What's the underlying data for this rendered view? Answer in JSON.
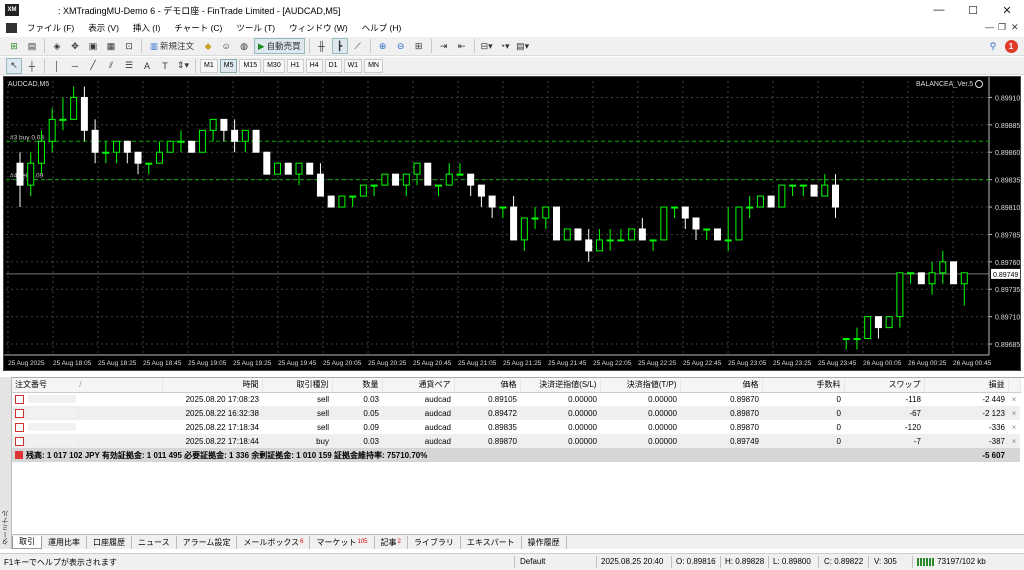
{
  "window": {
    "app_icon_text": "XM",
    "title": ": XMTradingMU-Demo 6 - デモロ座 - FinTrade Limited - [AUDCAD,M5]",
    "minimize": "—",
    "maximize": "☐",
    "close": "✕"
  },
  "menu": {
    "items": [
      "ファイル (F)",
      "表示 (V)",
      "挿入 (I)",
      "チャート (C)",
      "ツール (T)",
      "ウィンドウ (W)",
      "ヘルプ (H)"
    ],
    "mdi_min": "—",
    "mdi_restore": "❐",
    "mdi_close": "✕"
  },
  "toolbar": {
    "new_order": "新規注文",
    "auto_trading": "自動売買",
    "notification_count": "1",
    "timeframes": [
      "M1",
      "M5",
      "M15",
      "M30",
      "H1",
      "H4",
      "D1",
      "W1",
      "MN"
    ],
    "active_timeframe": "M5"
  },
  "chart": {
    "symbol_label": "AUDCAD,M5",
    "indicator_label": "BALANCEA_Ver.5",
    "current_price": "0.89749",
    "order_labels": [
      "#3 buy 0.03",
      "#4 sell 0.09"
    ],
    "colors": {
      "background": "#000000",
      "bull": "#00ff00",
      "bear": "#ffffff",
      "grid": "#404040",
      "order_line": "#00b000"
    }
  },
  "chart_data": {
    "type": "candlestick",
    "price_ticks": [
      "0.89910",
      "0.89885",
      "0.89860",
      "0.89835",
      "0.89810",
      "0.89785",
      "0.89760",
      "0.89735",
      "0.89710",
      "0.89685"
    ],
    "time_ticks": [
      "25 Aug 2025",
      "25 Aug 18:05",
      "25 Aug 18:25",
      "25 Aug 18:45",
      "25 Aug 19:05",
      "25 Aug 19:25",
      "25 Aug 19:45",
      "25 Aug 20:05",
      "25 Aug 20:25",
      "25 Aug 20:45",
      "25 Aug 21:05",
      "25 Aug 21:25",
      "25 Aug 21:45",
      "25 Aug 22:05",
      "25 Aug 22:25",
      "25 Aug 22:45",
      "25 Aug 23:05",
      "25 Aug 23:25",
      "25 Aug 23:45",
      "26 Aug 00:05",
      "26 Aug 00:25",
      "26 Aug 00:45"
    ],
    "ylim": [
      0.89675,
      0.89925
    ],
    "order_levels": [
      0.8987,
      0.89835
    ],
    "current_level": 0.89749,
    "candles": [
      [
        0.8985,
        0.8986,
        0.8981,
        0.8983
      ],
      [
        0.8983,
        0.8986,
        0.8982,
        0.8985
      ],
      [
        0.8985,
        0.8988,
        0.8984,
        0.8987
      ],
      [
        0.8987,
        0.899,
        0.8986,
        0.8989
      ],
      [
        0.8989,
        0.8991,
        0.8988,
        0.8989
      ],
      [
        0.8989,
        0.8992,
        0.8989,
        0.8991
      ],
      [
        0.8991,
        0.8992,
        0.8987,
        0.8988
      ],
      [
        0.8988,
        0.8989,
        0.8985,
        0.8986
      ],
      [
        0.8986,
        0.8987,
        0.8985,
        0.8986
      ],
      [
        0.8986,
        0.8987,
        0.8985,
        0.8987
      ],
      [
        0.8987,
        0.8987,
        0.8985,
        0.8986
      ],
      [
        0.8986,
        0.8986,
        0.8984,
        0.8985
      ],
      [
        0.8985,
        0.8985,
        0.8984,
        0.8985
      ],
      [
        0.8985,
        0.8987,
        0.8985,
        0.8986
      ],
      [
        0.8986,
        0.8987,
        0.8986,
        0.8987
      ],
      [
        0.8987,
        0.8988,
        0.8986,
        0.8987
      ],
      [
        0.8987,
        0.8987,
        0.8986,
        0.8986
      ],
      [
        0.8986,
        0.8988,
        0.8986,
        0.8988
      ],
      [
        0.8988,
        0.8989,
        0.8987,
        0.8989
      ],
      [
        0.8989,
        0.8989,
        0.8987,
        0.8988
      ],
      [
        0.8988,
        0.8989,
        0.8986,
        0.8987
      ],
      [
        0.8987,
        0.8988,
        0.8986,
        0.8988
      ],
      [
        0.8988,
        0.8988,
        0.8986,
        0.8986
      ],
      [
        0.8986,
        0.8986,
        0.8984,
        0.8984
      ],
      [
        0.8984,
        0.8985,
        0.8984,
        0.8985
      ],
      [
        0.8985,
        0.8985,
        0.8984,
        0.8984
      ],
      [
        0.8984,
        0.8985,
        0.8983,
        0.8985
      ],
      [
        0.8985,
        0.8985,
        0.8984,
        0.8984
      ],
      [
        0.8984,
        0.8985,
        0.8982,
        0.8982
      ],
      [
        0.8982,
        0.8982,
        0.8981,
        0.8981
      ],
      [
        0.8981,
        0.8982,
        0.8981,
        0.8982
      ],
      [
        0.8982,
        0.8982,
        0.8981,
        0.8982
      ],
      [
        0.8982,
        0.8983,
        0.8982,
        0.8983
      ],
      [
        0.8983,
        0.8983,
        0.8982,
        0.8983
      ],
      [
        0.8983,
        0.8984,
        0.8983,
        0.8984
      ],
      [
        0.8984,
        0.8984,
        0.8983,
        0.8983
      ],
      [
        0.8983,
        0.8984,
        0.8982,
        0.8984
      ],
      [
        0.8984,
        0.8985,
        0.8983,
        0.8985
      ],
      [
        0.8985,
        0.8985,
        0.8983,
        0.8983
      ],
      [
        0.8983,
        0.8983,
        0.8982,
        0.8983
      ],
      [
        0.8983,
        0.8985,
        0.8983,
        0.8984
      ],
      [
        0.8984,
        0.8985,
        0.8984,
        0.8984
      ],
      [
        0.8984,
        0.8984,
        0.8982,
        0.8983
      ],
      [
        0.8983,
        0.8983,
        0.8981,
        0.8982
      ],
      [
        0.8982,
        0.8982,
        0.898,
        0.8981
      ],
      [
        0.8981,
        0.8981,
        0.898,
        0.8981
      ],
      [
        0.8981,
        0.8982,
        0.8978,
        0.8978
      ],
      [
        0.8978,
        0.898,
        0.8977,
        0.898
      ],
      [
        0.898,
        0.8981,
        0.8979,
        0.898
      ],
      [
        0.898,
        0.8981,
        0.8979,
        0.8981
      ],
      [
        0.8981,
        0.8981,
        0.8978,
        0.8978
      ],
      [
        0.8978,
        0.8979,
        0.8978,
        0.8979
      ],
      [
        0.8979,
        0.8979,
        0.8978,
        0.8978
      ],
      [
        0.8978,
        0.8979,
        0.8976,
        0.8977
      ],
      [
        0.8977,
        0.8979,
        0.8977,
        0.8978
      ],
      [
        0.8978,
        0.8979,
        0.8977,
        0.8978
      ],
      [
        0.8978,
        0.8979,
        0.8978,
        0.8978
      ],
      [
        0.8978,
        0.8979,
        0.8978,
        0.8979
      ],
      [
        0.8979,
        0.898,
        0.8978,
        0.8978
      ],
      [
        0.8978,
        0.8978,
        0.8977,
        0.8978
      ],
      [
        0.8978,
        0.8981,
        0.8978,
        0.8981
      ],
      [
        0.8981,
        0.8981,
        0.898,
        0.8981
      ],
      [
        0.8981,
        0.8981,
        0.8979,
        0.898
      ],
      [
        0.898,
        0.898,
        0.8978,
        0.8979
      ],
      [
        0.8979,
        0.8979,
        0.8978,
        0.8979
      ],
      [
        0.8979,
        0.8979,
        0.8978,
        0.8978
      ],
      [
        0.8978,
        0.8981,
        0.8977,
        0.8978
      ],
      [
        0.8978,
        0.8981,
        0.8978,
        0.8981
      ],
      [
        0.8981,
        0.8982,
        0.898,
        0.8981
      ],
      [
        0.8981,
        0.8982,
        0.8981,
        0.8982
      ],
      [
        0.8982,
        0.8982,
        0.8981,
        0.8981
      ],
      [
        0.8981,
        0.8983,
        0.8981,
        0.8983
      ],
      [
        0.8983,
        0.8983,
        0.8982,
        0.8983
      ],
      [
        0.8983,
        0.8983,
        0.8982,
        0.8983
      ],
      [
        0.8983,
        0.8983,
        0.8982,
        0.8982
      ],
      [
        0.8982,
        0.8984,
        0.8982,
        0.8983
      ],
      [
        0.8983,
        0.8984,
        0.898,
        0.8981
      ],
      [
        0.8969,
        0.8969,
        0.8968,
        0.8969
      ],
      [
        0.8969,
        0.897,
        0.8968,
        0.8969
      ],
      [
        0.8969,
        0.8971,
        0.8969,
        0.8971
      ],
      [
        0.8971,
        0.8971,
        0.8969,
        0.897
      ],
      [
        0.897,
        0.8971,
        0.897,
        0.8971
      ],
      [
        0.8971,
        0.8975,
        0.897,
        0.8975
      ],
      [
        0.8975,
        0.8975,
        0.8974,
        0.8975
      ],
      [
        0.8975,
        0.8975,
        0.8974,
        0.8974
      ],
      [
        0.8974,
        0.8976,
        0.8973,
        0.8975
      ],
      [
        0.8975,
        0.8977,
        0.8974,
        0.8976
      ],
      [
        0.8976,
        0.8976,
        0.8974,
        0.8974
      ],
      [
        0.8974,
        0.8975,
        0.8972,
        0.8975
      ]
    ]
  },
  "table": {
    "headers": [
      "注文番号",
      "時間",
      "取引種別",
      "数量",
      "通貨ペア",
      "価格",
      "決済逆指値(S/L)",
      "決済指値(T/P)",
      "価格",
      "手数料",
      "スワップ",
      "損益"
    ],
    "rows": [
      [
        "",
        "2025.08.20 17:08:23",
        "sell",
        "0.03",
        "audcad",
        "0.89105",
        "0.00000",
        "0.00000",
        "0.89870",
        "0",
        "-118",
        "-2 449"
      ],
      [
        "",
        "2025.08.22 16:32:38",
        "sell",
        "0.05",
        "audcad",
        "0.89472",
        "0.00000",
        "0.00000",
        "0.89870",
        "0",
        "-67",
        "-2 123"
      ],
      [
        "",
        "2025.08.22 17:18:34",
        "sell",
        "0.09",
        "audcad",
        "0.89835",
        "0.00000",
        "0.00000",
        "0.89870",
        "0",
        "-120",
        "-336"
      ],
      [
        "",
        "2025.08.22 17:18:44",
        "buy",
        "0.03",
        "audcad",
        "0.89870",
        "0.00000",
        "0.00000",
        "0.89749",
        "0",
        "-7",
        "-387"
      ]
    ],
    "summary": "残高: 1 017 102 JPY  有効証拠金: 1 011 495  必要証拠金: 1 336  余剰証拠金: 1 010 159  証拠金維持率: 75710.70%",
    "summary_total": "-5 607",
    "close_glyph": "×"
  },
  "terminal_side_label": "ターミナル",
  "tabs": [
    {
      "label": "取引",
      "badge": ""
    },
    {
      "label": "運用比率",
      "badge": ""
    },
    {
      "label": "口座履歴",
      "badge": ""
    },
    {
      "label": "ニュース",
      "badge": ""
    },
    {
      "label": "アラーム設定",
      "badge": ""
    },
    {
      "label": "メールボックス",
      "badge": "6"
    },
    {
      "label": "マーケット",
      "badge": "105"
    },
    {
      "label": "記事",
      "badge": "2"
    },
    {
      "label": "ライブラリ",
      "badge": ""
    },
    {
      "label": "エキスパート",
      "badge": ""
    },
    {
      "label": "操作履歴",
      "badge": ""
    }
  ],
  "status": {
    "help": "F1キーでヘルプが表示されます",
    "profile": "Default",
    "datetime": "2025.08.25 20:40",
    "open": "O: 0.89816",
    "high": "H: 0.89828",
    "low": "L: 0.89800",
    "close": "C: 0.89822",
    "volume": "V: 305",
    "traffic": "73197/102 kb"
  }
}
